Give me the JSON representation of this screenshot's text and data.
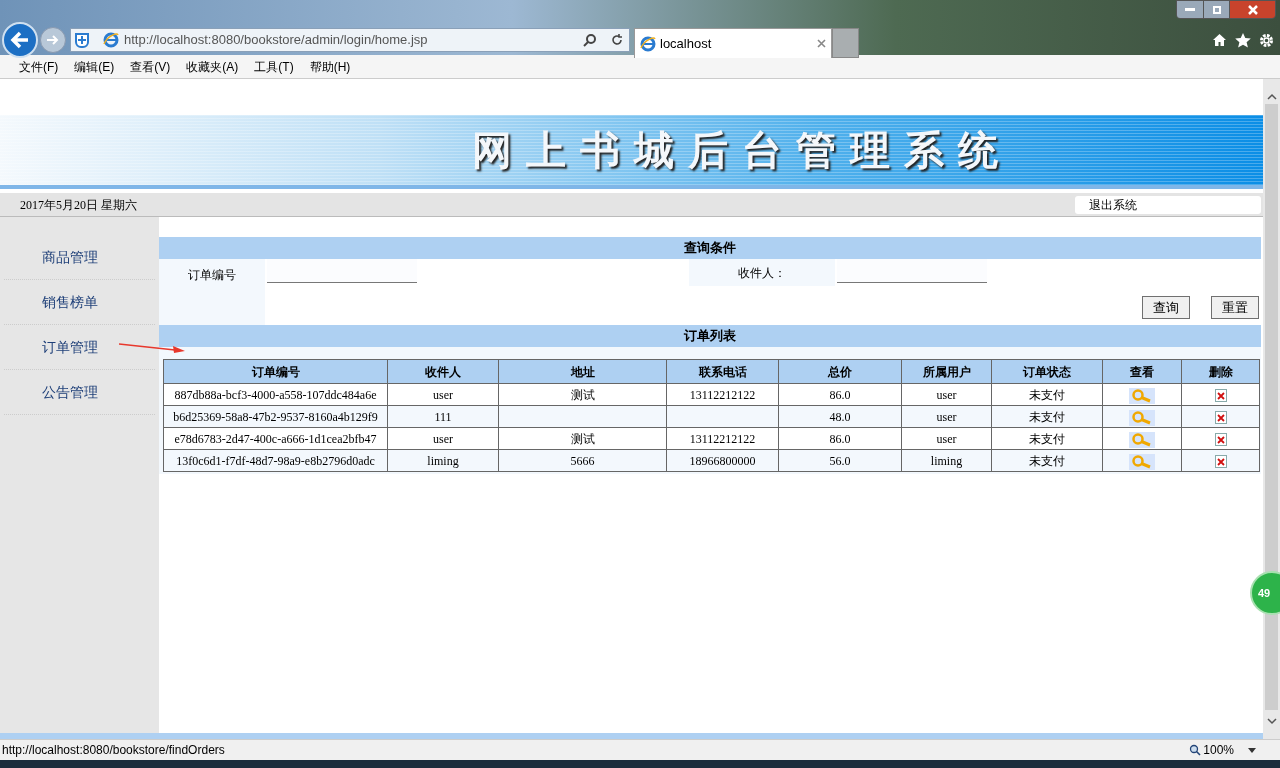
{
  "browser": {
    "url": "http://localhost:8080/bookstore/admin/login/home.jsp",
    "tab_title": "localhost",
    "menu": [
      "文件(F)",
      "编辑(E)",
      "查看(V)",
      "收藏夹(A)",
      "工具(T)",
      "帮助(H)"
    ],
    "status_url": "http://localhost:8080/bookstore/findOrders",
    "zoom": "100%"
  },
  "header": {
    "title": "网上书城后台管理系统",
    "date": "2017年5月20日 星期六",
    "logout": "退出系统"
  },
  "sidebar": {
    "items": [
      {
        "label": "商品管理"
      },
      {
        "label": "销售榜单"
      },
      {
        "label": "订单管理"
      },
      {
        "label": "公告管理"
      }
    ]
  },
  "query": {
    "title": "查询条件",
    "fields": [
      {
        "label": "订单编号"
      },
      {
        "label": "收件人："
      }
    ],
    "buttons": [
      "查询",
      "重置"
    ]
  },
  "orders": {
    "title": "订单列表",
    "columns": [
      "订单编号",
      "收件人",
      "地址",
      "联系电话",
      "总价",
      "所属用户",
      "订单状态",
      "查看",
      "删除"
    ],
    "rows": [
      {
        "cells": [
          "887db88a-bcf3-4000-a558-107ddc484a6e",
          "user",
          "测试",
          "13112212122",
          "86.0",
          "user",
          "未支付"
        ]
      },
      {
        "cells": [
          "b6d25369-58a8-47b2-9537-8160a4b129f9",
          "111",
          "",
          "",
          "48.0",
          "user",
          "未支付"
        ]
      },
      {
        "cells": [
          "e78d6783-2d47-400c-a666-1d1cea2bfb47",
          "user",
          "测试",
          "13112212122",
          "86.0",
          "user",
          "未支付"
        ]
      },
      {
        "cells": [
          "13f0c6d1-f7df-48d7-98a9-e8b2796d0adc",
          "liming",
          "5666",
          "18966800000",
          "56.0",
          "liming",
          "未支付"
        ]
      }
    ]
  },
  "side_badge": "49"
}
